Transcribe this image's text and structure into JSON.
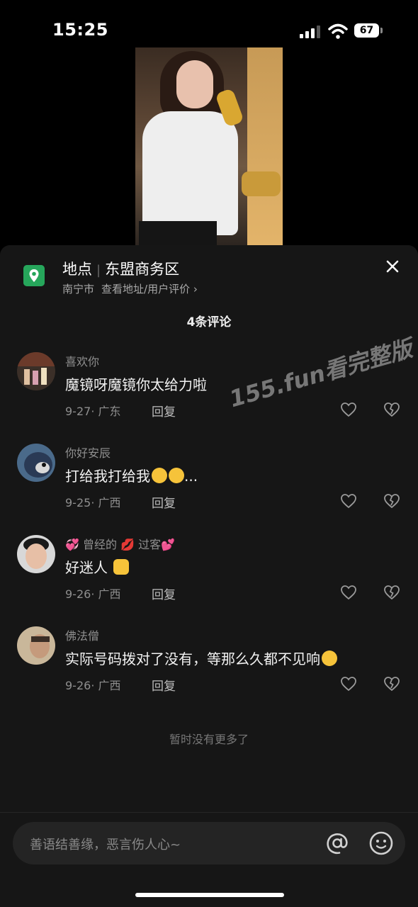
{
  "status": {
    "time": "15:25",
    "battery": "67"
  },
  "location": {
    "label": "地点",
    "name": "东盟商务区",
    "city": "南宁市",
    "link": "查看地址/用户评价 ›"
  },
  "comments_count": "4条评论",
  "watermark": "155.fun看完整版",
  "comments": [
    {
      "name": "喜欢你",
      "text": "魔镜呀魔镜你太给力啦",
      "date": "9-27",
      "region": "广东",
      "reply": "回复"
    },
    {
      "name": "你好安辰",
      "text": "打给我打给我",
      "suffix": "...",
      "date": "9-25",
      "region": "广西",
      "reply": "回复"
    },
    {
      "name_part1": "曾经的",
      "name_part2": "过客",
      "text": "好迷人",
      "date": "9-26",
      "region": "广西",
      "reply": "回复"
    },
    {
      "name": "佛法僧",
      "text": "实际号码拨对了没有，等那么久都不见响",
      "date": "9-26",
      "region": "广西",
      "reply": "回复"
    }
  ],
  "no_more": "暂时没有更多了",
  "input": {
    "placeholder": "善语结善缘，恶言伤人心~"
  },
  "icons": {
    "location": "location-pin-icon",
    "close": "close-icon",
    "like": "heart-icon",
    "dislike": "broken-heart-icon",
    "at": "at-icon",
    "emoji": "smile-icon"
  },
  "colors": {
    "sheet": "#161616",
    "location_green": "#26a65b",
    "muted": "#8f8f8f"
  }
}
